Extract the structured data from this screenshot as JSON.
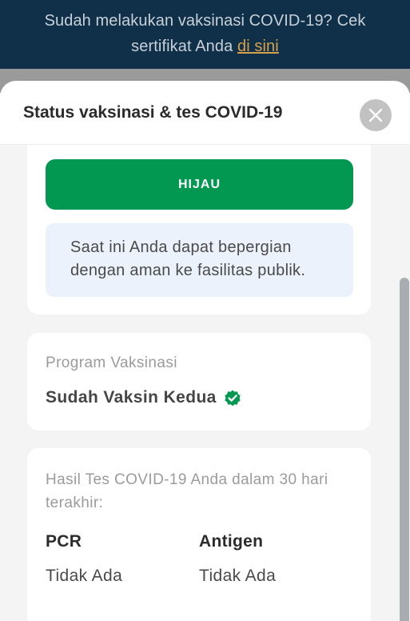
{
  "banner": {
    "line1": "Sudah melakukan vaksinasi COVID-19? Cek",
    "line2": "sertifikat Anda ",
    "link": "di sini"
  },
  "sheet": {
    "title": "Status vaksinasi & tes COVID-19",
    "close_icon": "close-icon"
  },
  "status": {
    "label": "HIJAU",
    "color": "#039851",
    "message": "Saat ini Anda dapat bepergian dengan aman ke fasilitas publik."
  },
  "vaccination": {
    "label": "Program Vaksinasi",
    "status": "Sudah Vaksin Kedua",
    "icon": "verified-badge-icon"
  },
  "tests": {
    "label": "Hasil Tes COVID-19 Anda dalam 30 hari terakhir:",
    "pcr": {
      "heading": "PCR",
      "value": "Tidak Ada"
    },
    "antigen": {
      "heading": "Antigen",
      "value": "Tidak Ada"
    }
  }
}
